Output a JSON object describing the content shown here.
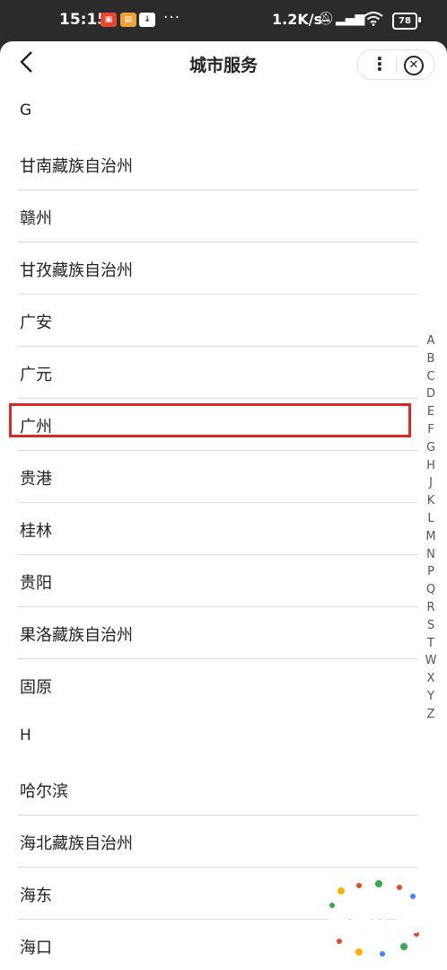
{
  "status_bar": {
    "time": "15:15",
    "dots": "···",
    "network_speed": "1.2K/s",
    "battery_level": "78",
    "icons": [
      "app-badge-icon",
      "app-icon",
      "download-icon",
      "mute-icon",
      "hd-signal-icon",
      "wifi-icon",
      "battery-icon"
    ]
  },
  "header": {
    "title": "城市服务",
    "back_icon": "chevron-left-icon",
    "more_icon": "more-vertical-icon",
    "close_icon": "close-circle-icon"
  },
  "list": [
    {
      "text": "G",
      "type": "letter"
    },
    {
      "text": "甘南藏族自治州",
      "type": "city"
    },
    {
      "text": "赣州",
      "type": "city"
    },
    {
      "text": "甘孜藏族自治州",
      "type": "city"
    },
    {
      "text": "广安",
      "type": "city"
    },
    {
      "text": "广元",
      "type": "city"
    },
    {
      "text": "广州",
      "type": "city",
      "highlighted": true
    },
    {
      "text": "贵港",
      "type": "city"
    },
    {
      "text": "桂林",
      "type": "city"
    },
    {
      "text": "贵阳",
      "type": "city"
    },
    {
      "text": "果洛藏族自治州",
      "type": "city"
    },
    {
      "text": "固原",
      "type": "city"
    },
    {
      "text": "H",
      "type": "letter"
    },
    {
      "text": "哈尔滨",
      "type": "city"
    },
    {
      "text": "海北藏族自治州",
      "type": "city"
    },
    {
      "text": "海东",
      "type": "city"
    },
    {
      "text": "海口",
      "type": "city"
    }
  ],
  "alphabet_index": [
    "A",
    "B",
    "C",
    "D",
    "E",
    "F",
    "G",
    "H",
    "J",
    "K",
    "L",
    "M",
    "N",
    "P",
    "Q",
    "R",
    "S",
    "T",
    "W",
    "X",
    "Y",
    "Z"
  ],
  "watermark": {
    "text": "宜美生活"
  },
  "colors": {
    "highlight": "#d42a2a",
    "background": "#ffffff",
    "status_bar": "#2b2b2b"
  }
}
